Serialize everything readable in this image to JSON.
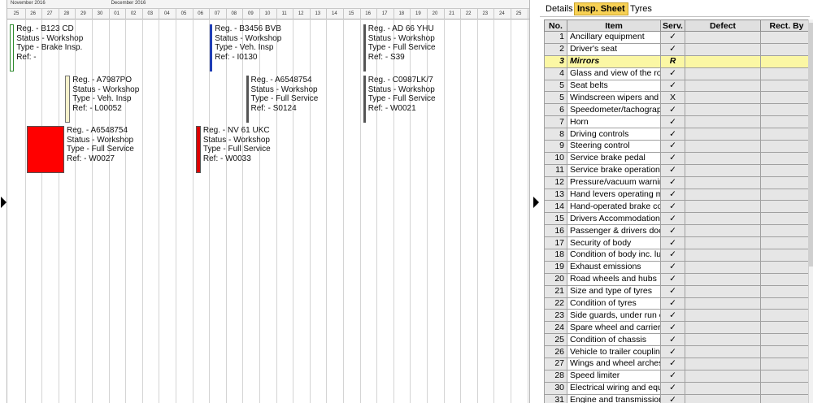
{
  "timeline": {
    "months": [
      {
        "label": "November 2016",
        "col": 0
      },
      {
        "label": "December 2016",
        "col": 6
      }
    ],
    "days": [
      "25",
      "26",
      "27",
      "28",
      "29",
      "30",
      "01",
      "02",
      "03",
      "04",
      "05",
      "06",
      "07",
      "08",
      "09",
      "10",
      "11",
      "12",
      "13",
      "14",
      "15",
      "16",
      "17",
      "18",
      "19",
      "20",
      "21",
      "22",
      "23",
      "24",
      "25"
    ]
  },
  "jobs": [
    {
      "col": 0.1,
      "row": 0,
      "span": 0.25,
      "bar_color": "#ffffff",
      "border_color": "#2e8a2e",
      "reg": "Reg. - B123 CD",
      "status": "Status - Workshop",
      "type": "Type - Brake Insp.",
      "ref": "Ref: -"
    },
    {
      "col": 12.05,
      "row": 0,
      "span": 0.1,
      "bar_color": "#1f3db5",
      "border_color": "#1f3db5",
      "reg": "Reg. - B3456 BVB",
      "status": "Status - Workshop",
      "type": "Type - Veh. Insp",
      "ref": "Ref: - I0130"
    },
    {
      "col": 21.2,
      "row": 0,
      "span": 0.05,
      "bar_color": "#555555",
      "border_color": "#555555",
      "reg": "Reg. - AD 66 YHU",
      "status": "Status - Workshop",
      "type": "Type - Full Service",
      "ref": "Ref: - S39"
    },
    {
      "col": 3.4,
      "row": 1,
      "span": 0.3,
      "bar_color": "#f6f2cc",
      "border_color": "#777777",
      "reg": "Reg. - A7987PO",
      "status": "Status - Workshop",
      "type": "Type - Veh. Insp",
      "ref": "Ref: - L00052"
    },
    {
      "col": 14.2,
      "row": 1,
      "span": 0.05,
      "bar_color": "#555555",
      "border_color": "#555555",
      "reg": "Reg. - A6548754",
      "status": "Status - Workshop",
      "type": "Type - Full Service",
      "ref": "Ref: - S0124"
    },
    {
      "col": 21.2,
      "row": 1,
      "span": 0.05,
      "bar_color": "#555555",
      "border_color": "#555555",
      "reg": "Reg. - C0987LK/7",
      "status": "Status - Workshop",
      "type": "Type - Full Service",
      "ref": "Ref: - W0021"
    },
    {
      "col": 1.1,
      "row": 2,
      "span": 2.25,
      "bar_color": "#ff0000",
      "border_color": "#555555",
      "reg": "Reg. - A6548754",
      "status": "Status - Workshop",
      "type": "Type - Full Service",
      "ref": "Ref: - W0027"
    },
    {
      "col": 11.2,
      "row": 2,
      "span": 0.3,
      "bar_color": "#dd0000",
      "border_color": "#555555",
      "reg": "Reg. - NV 61 UKC",
      "status": "Status - Workshop",
      "type": "Type - Full Service",
      "ref": "Ref: - W0033"
    }
  ],
  "tabs": [
    {
      "label": "Details",
      "active": false
    },
    {
      "label": "Insp. Sheet",
      "active": true
    },
    {
      "label": "Tyres",
      "active": false
    }
  ],
  "table": {
    "headers": {
      "no": "No.",
      "item": "Item",
      "serv": "Serv.",
      "defect": "Defect",
      "rect": "Rect. By"
    },
    "rows": [
      {
        "no": "1",
        "item": "Ancillary equipment",
        "serv": "✓"
      },
      {
        "no": "2",
        "item": "Driver's seat",
        "serv": "✓"
      },
      {
        "no": "3",
        "item": "Mirrors",
        "serv": "R",
        "selected": true
      },
      {
        "no": "4",
        "item": "Glass and view of the ro",
        "serv": "✓"
      },
      {
        "no": "5",
        "item": "Seat belts",
        "serv": "✓"
      },
      {
        "no": "5",
        "item": "Windscreen wipers and",
        "serv": "X"
      },
      {
        "no": "6",
        "item": "Speedometer/tachograp",
        "serv": "✓"
      },
      {
        "no": "7",
        "item": "Horn",
        "serv": "✓"
      },
      {
        "no": "8",
        "item": "Driving controls",
        "serv": "✓"
      },
      {
        "no": "9",
        "item": "Steering control",
        "serv": "✓"
      },
      {
        "no": "10",
        "item": "Service brake pedal",
        "serv": "✓"
      },
      {
        "no": "11",
        "item": "Service brake operation",
        "serv": "✓"
      },
      {
        "no": "12",
        "item": "Pressure/vacuum warnir",
        "serv": "✓"
      },
      {
        "no": "13",
        "item": "Hand levers operating m",
        "serv": "✓"
      },
      {
        "no": "14",
        "item": "Hand-operated brake co",
        "serv": "✓"
      },
      {
        "no": "15",
        "item": "Drivers Accommodation",
        "serv": "✓"
      },
      {
        "no": "16",
        "item": "Passenger & drivers doc",
        "serv": "✓"
      },
      {
        "no": "17",
        "item": "Security of body",
        "serv": "✓"
      },
      {
        "no": "18",
        "item": "Condition of body inc. lu",
        "serv": "✓"
      },
      {
        "no": "19",
        "item": "Exhaust emissions",
        "serv": "✓"
      },
      {
        "no": "20",
        "item": "Road wheels and hubs",
        "serv": "✓"
      },
      {
        "no": "21",
        "item": "Size and type of tyres",
        "serv": "✓"
      },
      {
        "no": "22",
        "item": "Condition of tyres",
        "serv": "✓"
      },
      {
        "no": "23",
        "item": "Side guards, under run c",
        "serv": "✓"
      },
      {
        "no": "24",
        "item": "Spare wheel and carrier",
        "serv": "✓"
      },
      {
        "no": "25",
        "item": "Condition of chassis",
        "serv": "✓"
      },
      {
        "no": "26",
        "item": "Vehicle to trailer couplin",
        "serv": "✓"
      },
      {
        "no": "27",
        "item": "Wings and wheel arches",
        "serv": "✓"
      },
      {
        "no": "28",
        "item": "Speed limiter",
        "serv": "✓"
      },
      {
        "no": "30",
        "item": "Electrical wiring and equ",
        "serv": "✓"
      },
      {
        "no": "31",
        "item": "Engine and transmission",
        "serv": "✓"
      }
    ]
  }
}
